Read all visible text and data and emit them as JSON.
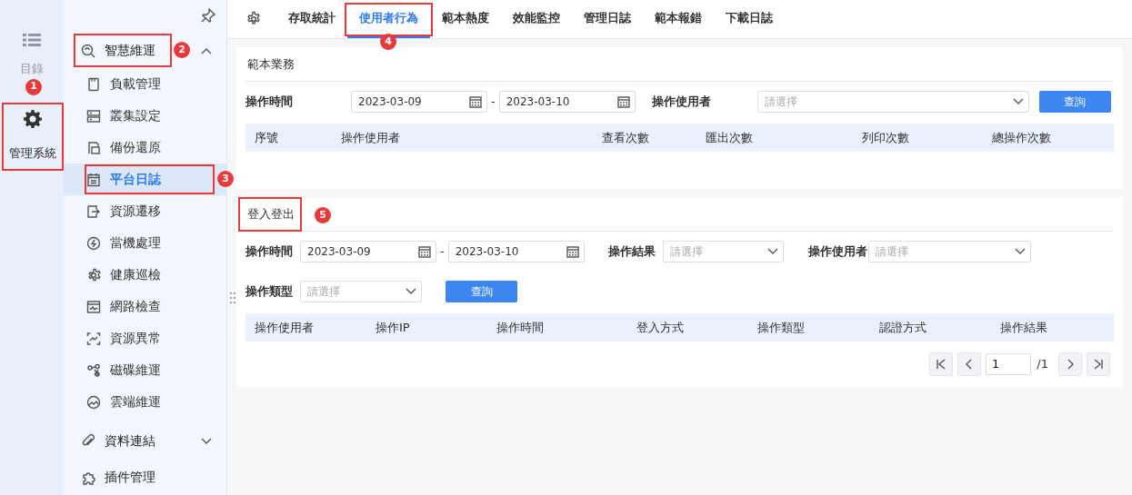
{
  "rail": {
    "items": [
      {
        "label": "目錄",
        "selected": false
      },
      {
        "label": "管理系統",
        "selected": true,
        "callout": "1"
      }
    ]
  },
  "sidebar": {
    "groups": [
      {
        "label": "智慧維運",
        "expanded": true,
        "callout": "2",
        "children": [
          {
            "label": "負載管理",
            "selected": false
          },
          {
            "label": "叢集設定",
            "selected": false
          },
          {
            "label": "備份還原",
            "selected": false
          },
          {
            "label": "平台日誌",
            "selected": true,
            "callout": "3"
          },
          {
            "label": "資源遷移",
            "selected": false
          },
          {
            "label": "當機處理",
            "selected": false
          },
          {
            "label": "健康巡檢",
            "selected": false
          },
          {
            "label": "網路檢查",
            "selected": false
          },
          {
            "label": "資源異常",
            "selected": false
          },
          {
            "label": "磁碟維運",
            "selected": false
          },
          {
            "label": "雲端維運",
            "selected": false
          }
        ]
      },
      {
        "label": "資料連結",
        "expanded": false
      },
      {
        "label": "插件管理"
      }
    ]
  },
  "tabs": [
    {
      "label": "存取統計",
      "selected": false
    },
    {
      "label": "使用者行為",
      "selected": true,
      "callout": "4"
    },
    {
      "label": "範本熱度",
      "selected": false
    },
    {
      "label": "效能監控",
      "selected": false
    },
    {
      "label": "管理日誌",
      "selected": false
    },
    {
      "label": "範本報錯",
      "selected": false
    },
    {
      "label": "下載日誌",
      "selected": false
    }
  ],
  "panels": [
    {
      "title": "範本業務",
      "filters": [
        {
          "kind": "date-range",
          "label": "操作時間",
          "from": "2023-03-09",
          "separator": "-",
          "to": "2023-03-10"
        },
        {
          "kind": "select",
          "label": "操作使用者",
          "placeholder": "請選擇"
        }
      ],
      "button": "查詢",
      "columns": [
        "序號",
        "操作使用者",
        "查看次數",
        "匯出次數",
        "列印次數",
        "總操作次數"
      ]
    },
    {
      "title": "登入登出",
      "callout": "5",
      "filters": [
        {
          "kind": "date-range",
          "label": "操作時間",
          "from": "2023-03-09",
          "separator": "-",
          "to": "2023-03-10"
        },
        {
          "kind": "select",
          "label": "操作結果",
          "placeholder": "請選擇"
        },
        {
          "kind": "select",
          "label": "操作使用者",
          "placeholder": "請選擇"
        },
        {
          "kind": "select",
          "label": "操作類型",
          "placeholder": "請選擇"
        }
      ],
      "button": "查詢",
      "columns": [
        "操作使用者",
        "操作IP",
        "操作時間",
        "登入方式",
        "操作類型",
        "認證方式",
        "操作結果"
      ],
      "pagination": {
        "page": "1",
        "total": "/1"
      }
    }
  ]
}
